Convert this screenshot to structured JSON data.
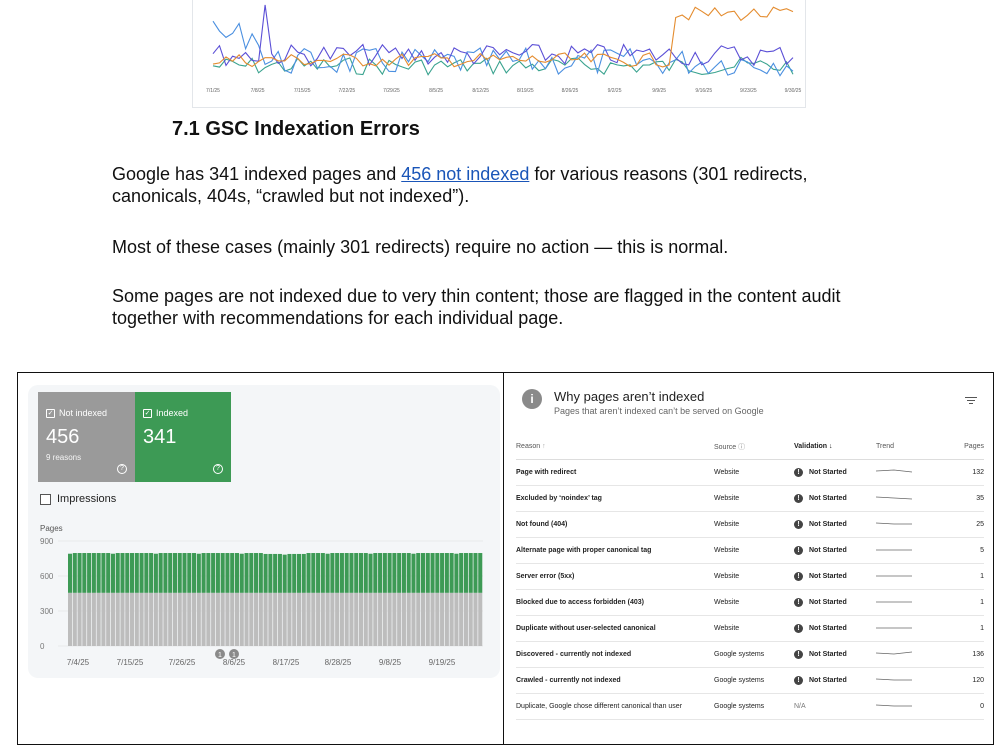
{
  "top_chart": {
    "x_ticks": [
      "7/1/25",
      "7/8/25",
      "7/15/25",
      "7/22/25",
      "7/29/25",
      "8/5/25",
      "8/12/25",
      "8/19/25",
      "8/26/25",
      "9/2/25",
      "9/9/25",
      "9/16/25",
      "9/23/25",
      "9/30/25"
    ],
    "colors": {
      "purple": "#5b4fd6",
      "orange": "#e48c2f",
      "blue": "#4a8fe0",
      "green": "#3aa38f"
    }
  },
  "doc": {
    "heading": "7.1 GSC Indexation Errors",
    "p1_before": "Google has 341 indexed pages and ",
    "p1_link": "456 not indexed",
    "p1_after": " for various reasons (301 redirects, canonicals, 404s, “crawled but not indexed”).",
    "p2": "Most of these cases (mainly 301 redirects) require no action — this is normal.",
    "p3": "Some pages are not indexed due to very thin content; those are flagged in the content audit together with recommendations for each individual page."
  },
  "gsc": {
    "not_indexed": {
      "label": "Not indexed",
      "value": "456",
      "sub": "9 reasons"
    },
    "indexed": {
      "label": "Indexed",
      "value": "341"
    },
    "impressions_label": "Impressions",
    "y_axis_label": "Pages",
    "y_ticks": [
      "900",
      "600",
      "300",
      "0"
    ],
    "x_ticks": [
      "7/4/25",
      "7/15/25",
      "7/26/25",
      "8/6/25",
      "8/17/25",
      "8/28/25",
      "9/8/25",
      "9/19/25"
    ],
    "markers": [
      "1",
      "1"
    ],
    "colors": {
      "indexed": "#3d9a55",
      "not_indexed": "#bdbdbd"
    }
  },
  "chart_data": {
    "type": "bar",
    "stacked": true,
    "series": [
      {
        "name": "Not indexed",
        "value": 456
      },
      {
        "name": "Indexed",
        "value": 341
      }
    ],
    "bars": 87,
    "y_axis": {
      "label": "Pages",
      "range": [
        0,
        900
      ]
    }
  },
  "why": {
    "title": "Why pages aren’t indexed",
    "subtitle": "Pages that aren’t indexed can’t be served on Google",
    "columns": {
      "reason": "Reason",
      "source": "Source",
      "validation": "Validation",
      "trend": "Trend",
      "pages": "Pages"
    },
    "rows": [
      {
        "reason": "Page with redirect",
        "source": "Website",
        "validation": "Not Started",
        "pages": "132"
      },
      {
        "reason": "Excluded by ‘noindex’ tag",
        "source": "Website",
        "validation": "Not Started",
        "pages": "35"
      },
      {
        "reason": "Not found (404)",
        "source": "Website",
        "validation": "Not Started",
        "pages": "25"
      },
      {
        "reason": "Alternate page with proper canonical tag",
        "source": "Website",
        "validation": "Not Started",
        "pages": "5"
      },
      {
        "reason": "Server error (5xx)",
        "source": "Website",
        "validation": "Not Started",
        "pages": "1"
      },
      {
        "reason": "Blocked due to access forbidden (403)",
        "source": "Website",
        "validation": "Not Started",
        "pages": "1"
      },
      {
        "reason": "Duplicate without user-selected canonical",
        "source": "Website",
        "validation": "Not Started",
        "pages": "1"
      },
      {
        "reason": "Discovered - currently not indexed",
        "source": "Google systems",
        "validation": "Not Started",
        "pages": "136"
      },
      {
        "reason": "Crawled - currently not indexed",
        "source": "Google systems",
        "validation": "Not Started",
        "pages": "120"
      },
      {
        "reason": "Duplicate, Google chose different canonical than user",
        "source": "Google systems",
        "validation": "N/A",
        "pages": "0"
      }
    ]
  }
}
